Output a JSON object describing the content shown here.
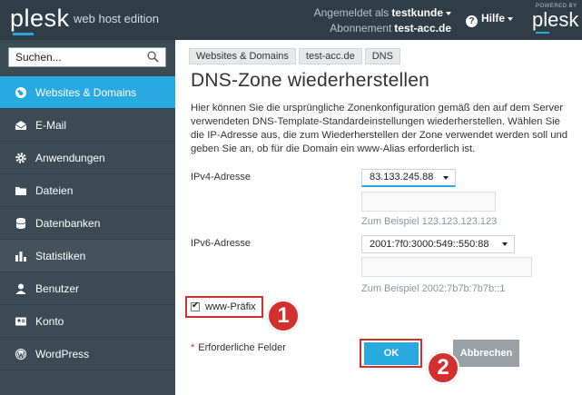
{
  "header": {
    "logo": "plesk",
    "edition": "web host edition",
    "logged_in_label": "Angemeldet als",
    "logged_in_user": "testkunde",
    "subscription_label": "Abonnement",
    "subscription_value": "test-acc.de",
    "help_label": "Hilfe",
    "powered_by": "POWERED BY",
    "powered_logo": "plesk"
  },
  "sidebar": {
    "search_placeholder": "Suchen...",
    "items": [
      {
        "label": "Websites & Domains",
        "icon": "globe-icon",
        "active": true
      },
      {
        "label": "E-Mail",
        "icon": "envelope-icon"
      },
      {
        "label": "Anwendungen",
        "icon": "gear-icon"
      },
      {
        "label": "Dateien",
        "icon": "folder-icon"
      },
      {
        "label": "Datenbanken",
        "icon": "database-icon"
      },
      {
        "label": "Statistiken",
        "icon": "bar-chart-icon"
      },
      {
        "label": "Benutzer",
        "icon": "user-icon"
      },
      {
        "label": "Konto",
        "icon": "id-card-icon"
      },
      {
        "label": "WordPress",
        "icon": "wordpress-icon"
      }
    ]
  },
  "breadcrumb": [
    "Websites & Domains",
    "test-acc.de",
    "DNS"
  ],
  "page_title": "DNS-Zone wiederherstellen",
  "description": "Hier können Sie die ursprüngliche Zonenkonfiguration gemäß den auf dem Server verwendeten DNS-Template-Standardeinstellungen wiederherstellen. Wählen Sie die IP-Adresse aus, die zum Wiederherstellen der Zone verwendet werden soll und geben Sie an, ob für die Domain ein www-Alias erforderlich ist.",
  "form": {
    "ipv4_label": "IPv4-Adresse",
    "ipv4_selected": "83.133.245.88",
    "ipv4_hint": "Zum Beispiel 123.123.123.123",
    "ipv6_label": "IPv6-Adresse",
    "ipv6_selected": "2001:7f0:3000:549::550:88",
    "ipv6_hint": "Zum Beispiel 2002:7b7b:7b7b::1",
    "www_label": "www-Präfix",
    "required_label": "Erforderliche Felder",
    "ok_label": "OK",
    "cancel_label": "Abbrechen"
  },
  "annotations": {
    "step1": "1",
    "step2": "2"
  },
  "colors": {
    "header_bg": "#303d47",
    "sidebar_bg": "#3c4a54",
    "accent": "#28aae1",
    "highlight": "#d32f2f"
  }
}
